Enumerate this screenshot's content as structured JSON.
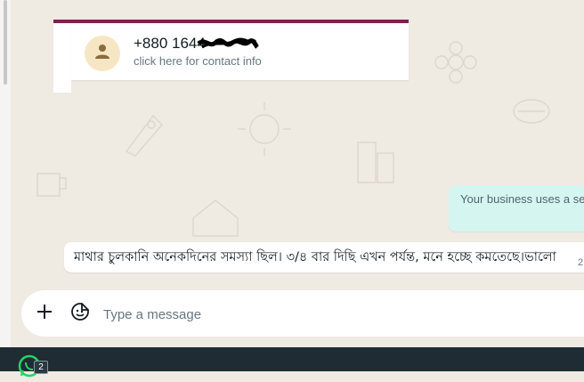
{
  "contact_card": {
    "phone": "+880 1644",
    "subtitle": "click here for contact info",
    "accent_color": "#7b2350"
  },
  "system_notice": {
    "text": "Your business uses a sec"
  },
  "message": {
    "text": "মাথার চুলকানি অনেকদিনের সমস্যা ছিল। ৩/৪ বার দিছি এখন পর্যন্ত, মনে হচ্ছে কমতেছে।ভালো",
    "time": "2"
  },
  "composer": {
    "placeholder": "Type a message",
    "attach_icon": "plus-icon",
    "sticker_icon": "sticker-icon"
  },
  "taskbar": {
    "app_icon": "whatsapp-icon",
    "badge_count": "2"
  }
}
